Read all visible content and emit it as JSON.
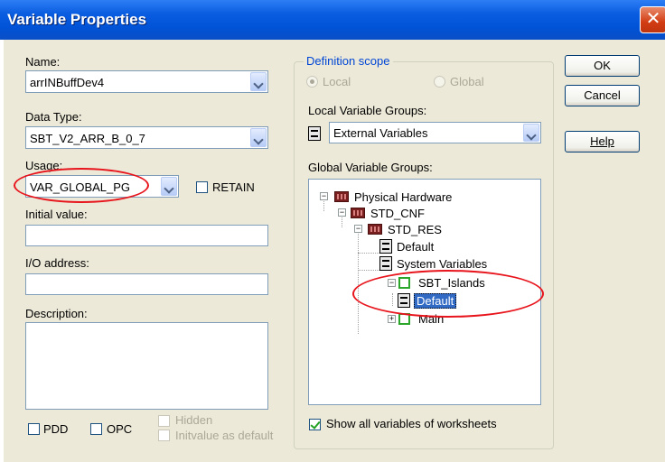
{
  "dialog": {
    "title": "Variable Properties",
    "close_glyph": "✕"
  },
  "left": {
    "name_label": "Name:",
    "name_value": "arrINBuffDev4",
    "datatype_label": "Data Type:",
    "datatype_value": "SBT_V2_ARR_B_0_7",
    "usage_label": "Usage:",
    "usage_value": "VAR_GLOBAL_PG",
    "retain_label": "RETAIN",
    "initial_label": "Initial value:",
    "initial_value": "",
    "io_label": "I/O address:",
    "io_value": "",
    "description_label": "Description:",
    "description_value": "",
    "pdd_label": "PDD",
    "opc_label": "OPC",
    "hidden_label": "Hidden",
    "initvalue_default_label": "Initvalue as default"
  },
  "scope": {
    "group_title": "Definition scope",
    "local_label": "Local",
    "global_label": "Global",
    "local_groups_label": "Local Variable Groups:",
    "local_groups_value": "External Variables",
    "global_groups_label": "Global Variable Groups:",
    "show_all_label": "Show all variables of worksheets",
    "show_all_checked": true
  },
  "tree": {
    "physical_hardware": "Physical Hardware",
    "std_cnf": "STD_CNF",
    "std_res": "STD_RES",
    "default": "Default",
    "system_variables": "System Variables",
    "sbt_islands": "SBT_Islands",
    "islands_default": "Default",
    "main": "Main"
  },
  "buttons": {
    "ok": "OK",
    "cancel": "Cancel",
    "help": "Help"
  },
  "colors": {
    "titlebar": "#0a5ce0",
    "dialog_bg": "#ece9d8",
    "annotation_oval": "#e8141c",
    "selection": "#316ac5"
  }
}
